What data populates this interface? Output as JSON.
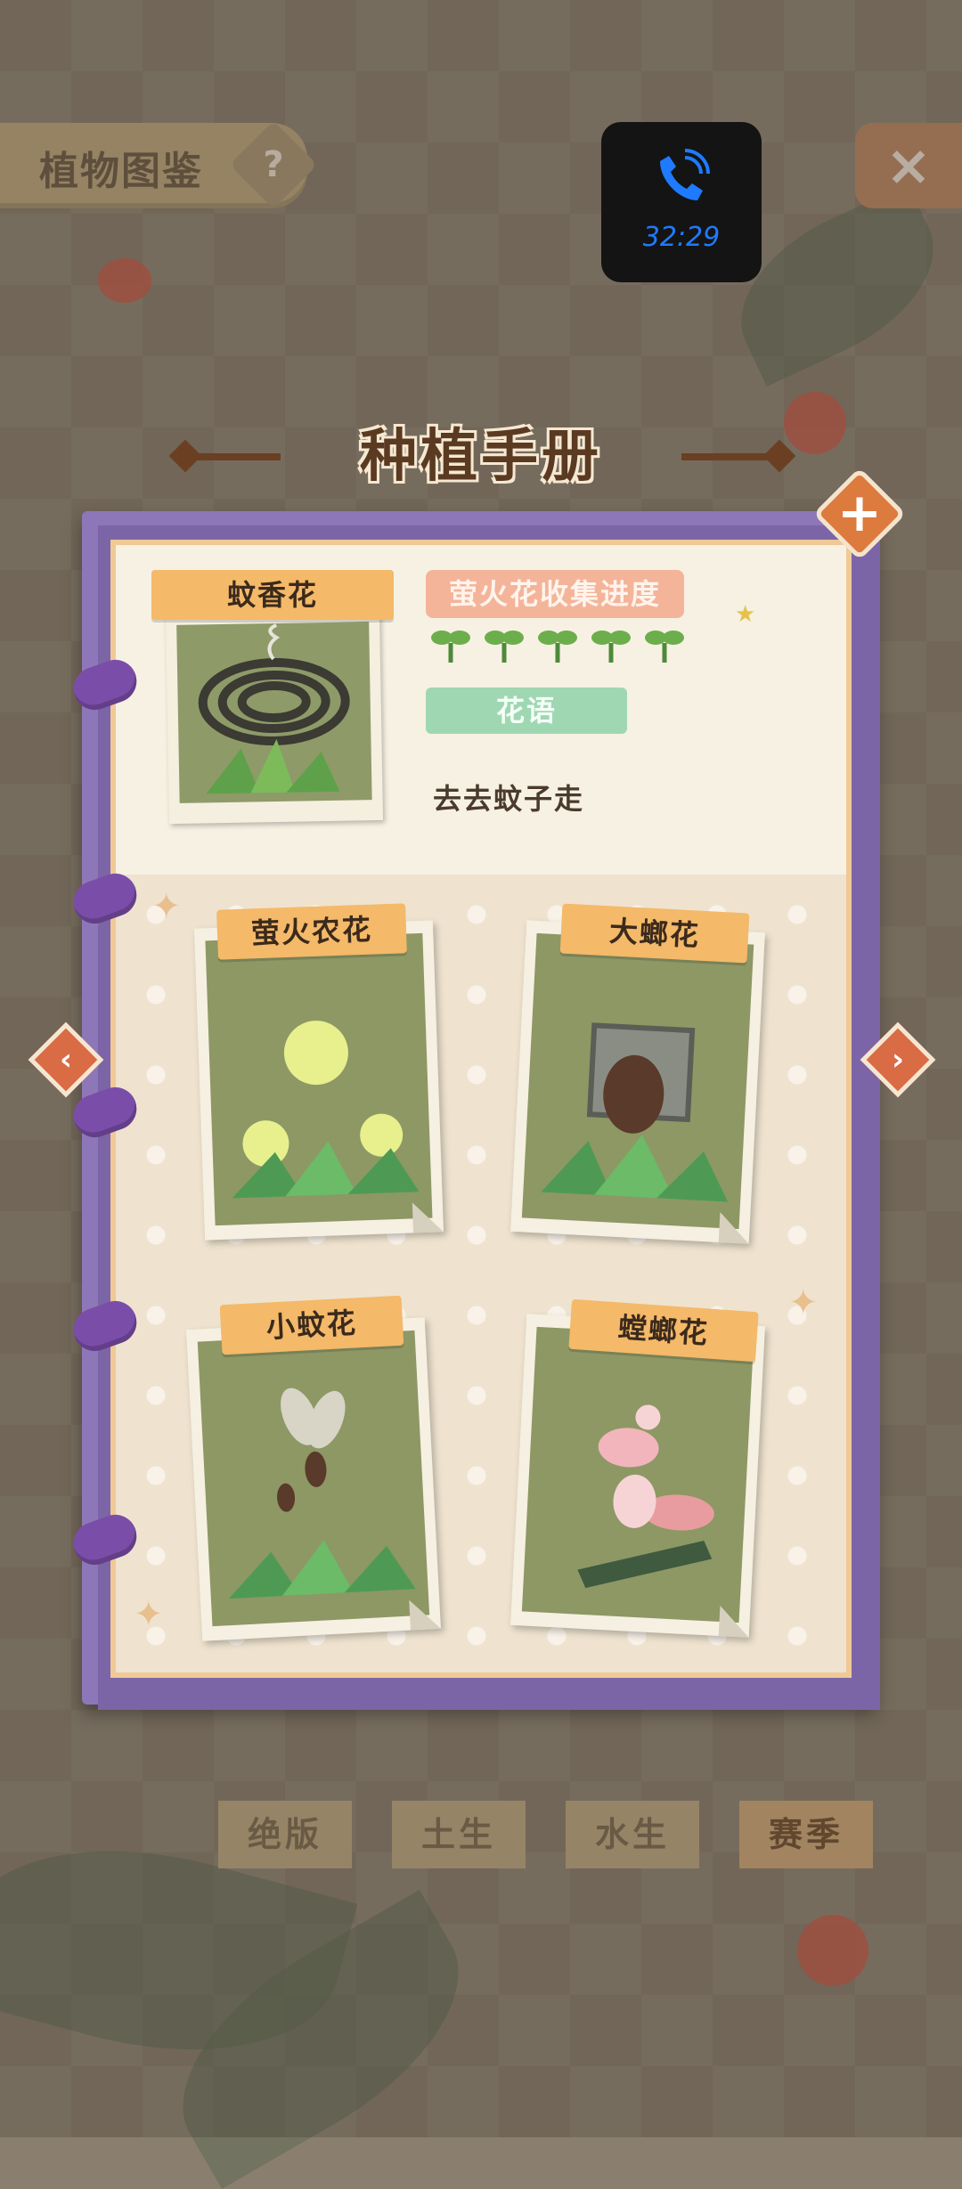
{
  "background": {
    "title": "植物图鉴",
    "help_icon": "?",
    "close_icon": "×",
    "tabs": [
      {
        "label": "绝版",
        "active": false
      },
      {
        "label": "土生",
        "active": false
      },
      {
        "label": "水生",
        "active": false
      },
      {
        "label": "赛季",
        "active": true
      }
    ]
  },
  "call_overlay": {
    "icon": "phone-icon",
    "time": "32:29",
    "color": "#1e7bff"
  },
  "manual": {
    "title": "种植手册",
    "featured": {
      "name": "蚊香花",
      "progress_label": "萤火花收集进度",
      "progress_sprouts": 5,
      "language_label": "花语",
      "language_text": "去去蚊子走"
    },
    "plants": [
      {
        "name": "萤火农花",
        "icon": "firefly-flower-icon"
      },
      {
        "name": "大螂花",
        "icon": "beetle-flower-icon"
      },
      {
        "name": "小蚊花",
        "icon": "mosquito-flower-icon"
      },
      {
        "name": "螳螂花",
        "icon": "mantis-flower-icon"
      }
    ],
    "prev_icon": "‹",
    "next_icon": "›",
    "add_icon": "+"
  }
}
